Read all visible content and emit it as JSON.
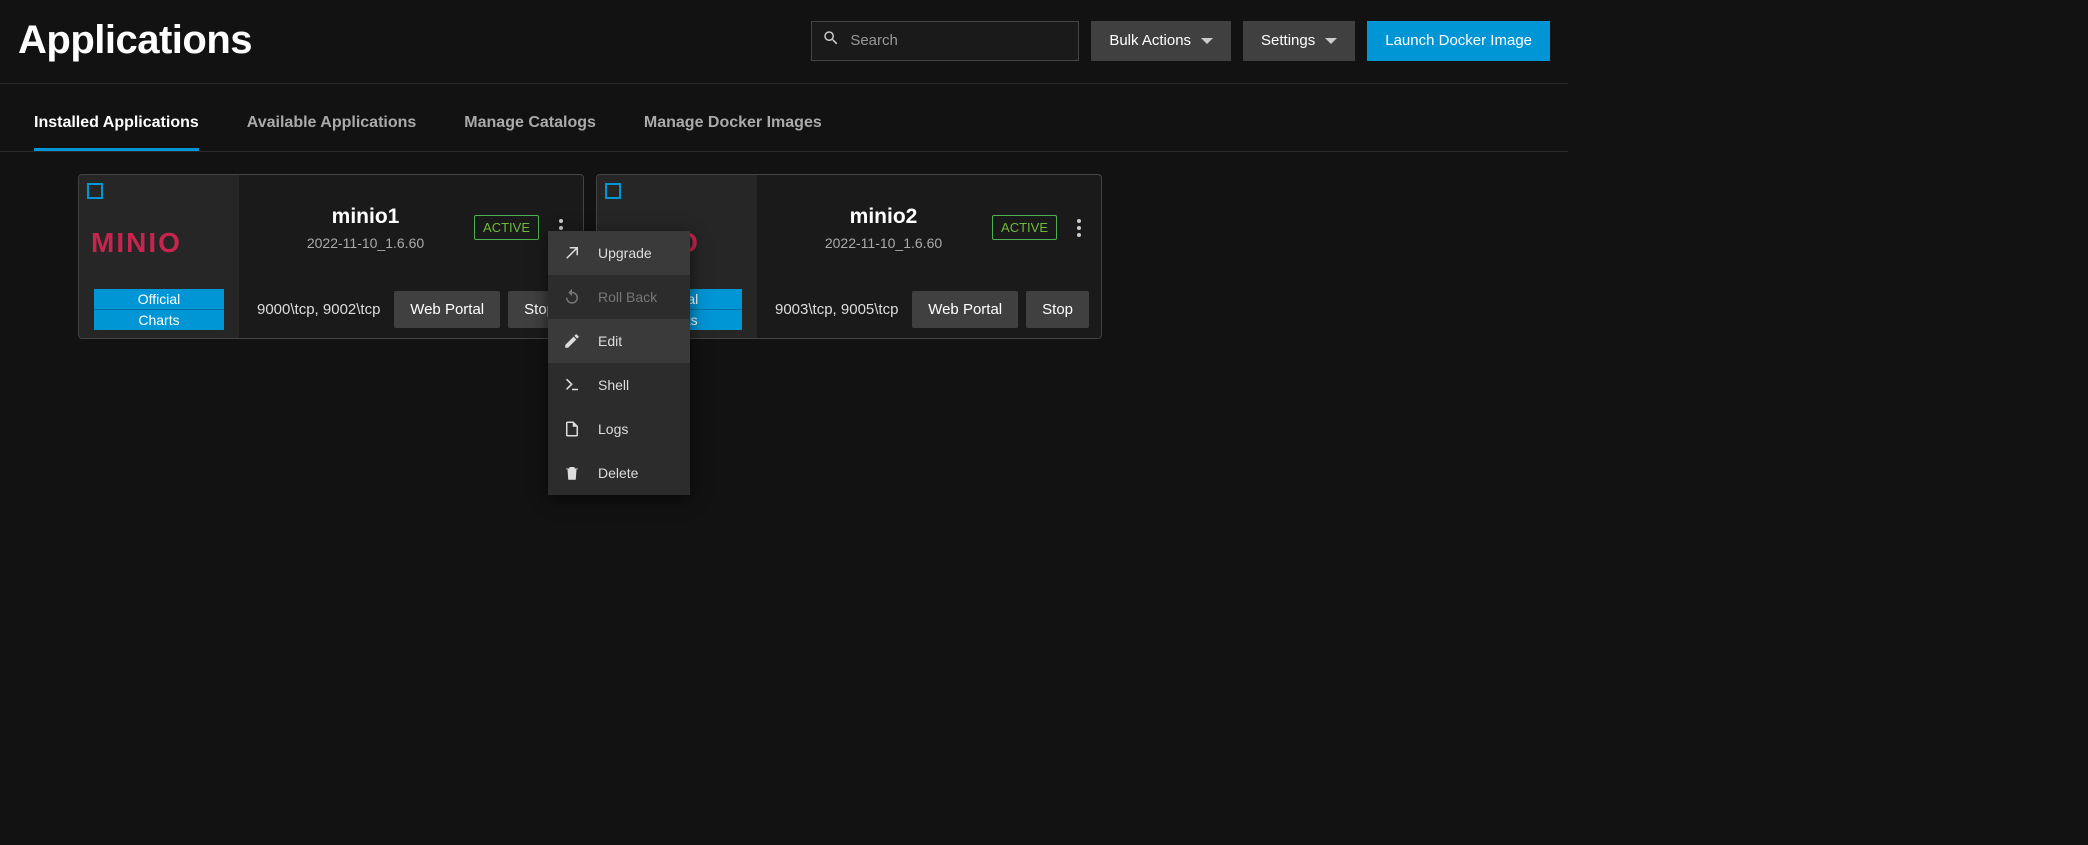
{
  "header": {
    "title": "Applications",
    "search_placeholder": "Search",
    "bulk_actions_label": "Bulk Actions",
    "settings_label": "Settings",
    "launch_label": "Launch Docker Image"
  },
  "tabs": {
    "installed": "Installed Applications",
    "available": "Available Applications",
    "catalogs": "Manage Catalogs",
    "docker": "Manage Docker Images"
  },
  "apps": [
    {
      "logo_text": "MINIO",
      "name": "minio1",
      "version": "2022-11-10_1.6.60",
      "status": "ACTIVE",
      "tag1": "Official",
      "tag2": "Charts",
      "ports": "9000\\tcp, 9002\\tcp",
      "web_portal": "Web Portal",
      "stop": "Stop"
    },
    {
      "logo_text": "MINIO",
      "name": "minio2",
      "version": "2022-11-10_1.6.60",
      "status": "ACTIVE",
      "tag1": "Official",
      "tag2": "Charts",
      "ports": "9003\\tcp, 9005\\tcp",
      "web_portal": "Web Portal",
      "stop": "Stop"
    }
  ],
  "menu": {
    "upgrade": "Upgrade",
    "rollback": "Roll Back",
    "edit": "Edit",
    "shell": "Shell",
    "logs": "Logs",
    "delete": "Delete"
  }
}
